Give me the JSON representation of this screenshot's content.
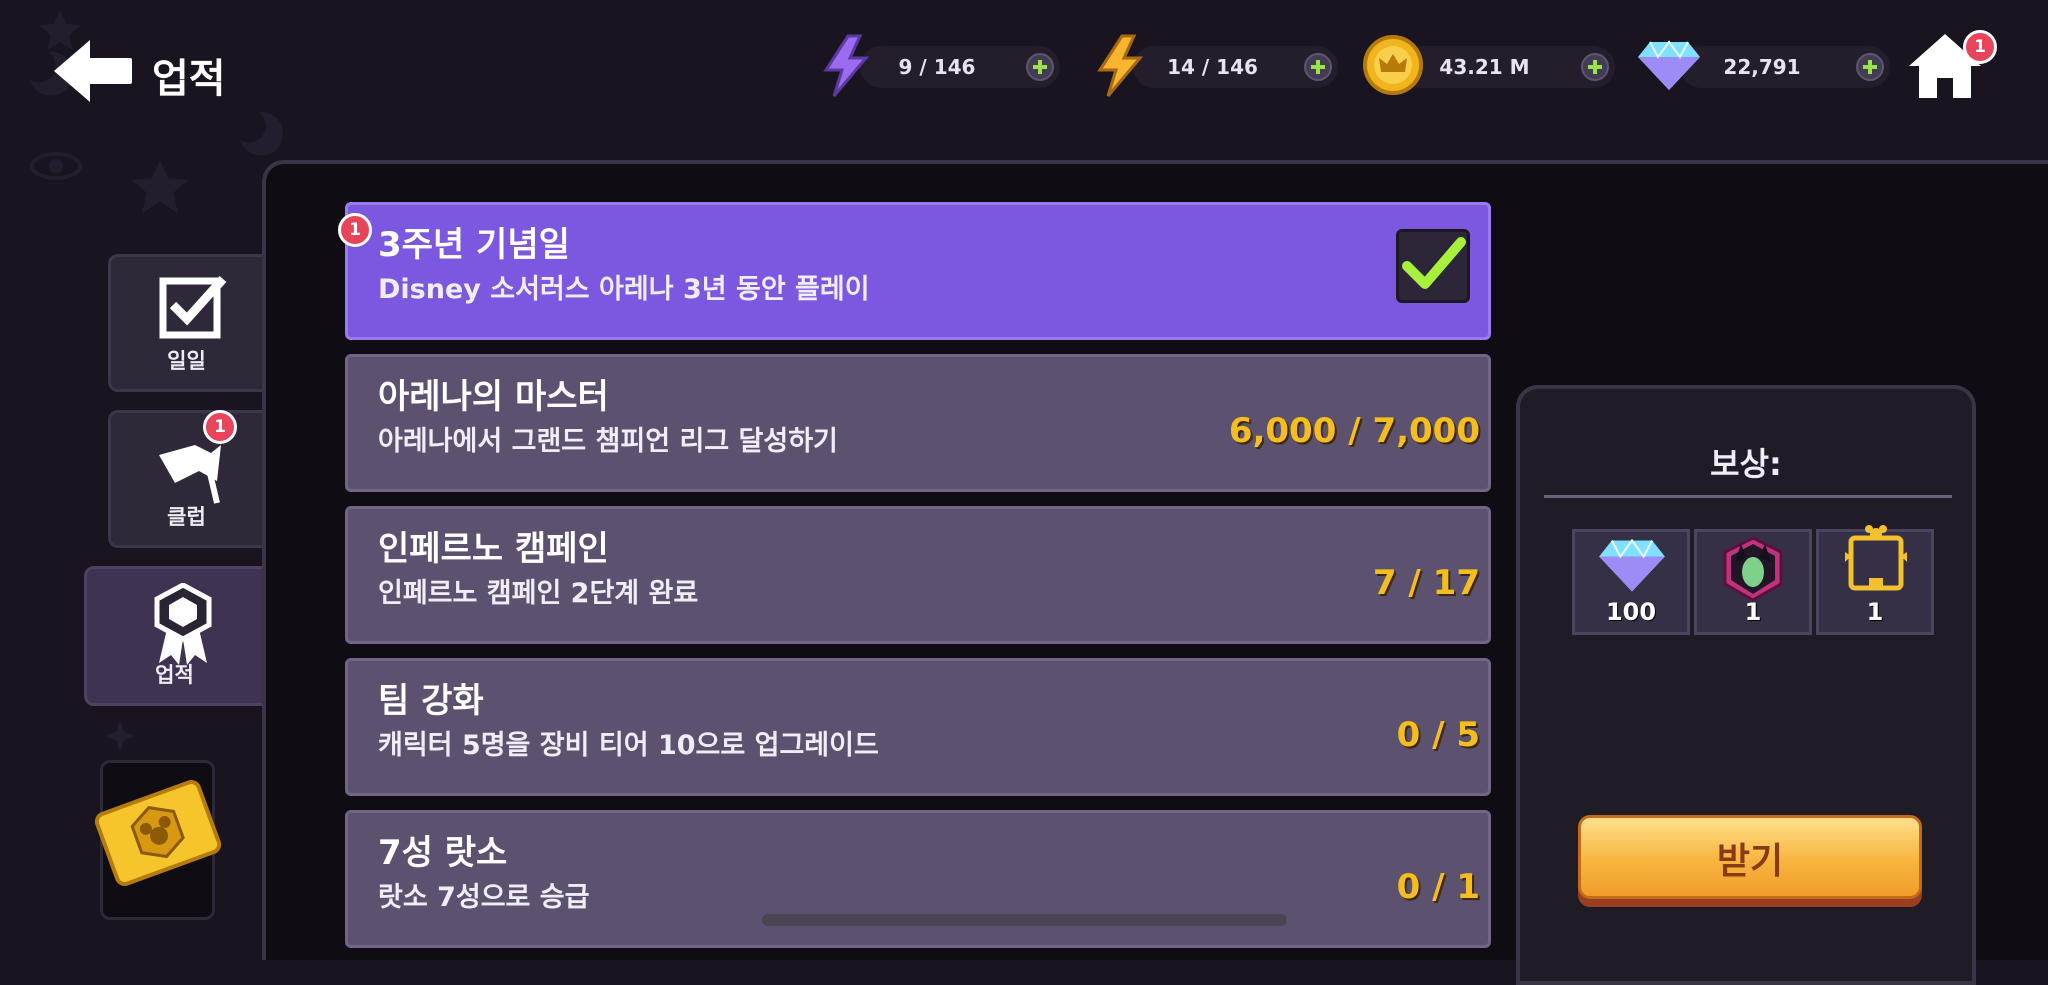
{
  "header": {
    "title": "업적",
    "back_icon": "back-arrow-icon",
    "home_icon": "home-icon",
    "home_badge": "1"
  },
  "resources": [
    {
      "name": "purple-energy",
      "icon": "lightning-purple-icon",
      "value": "9 / 146",
      "color": "#9b6cf0"
    },
    {
      "name": "gold-energy",
      "icon": "lightning-gold-icon",
      "value": "14 / 146",
      "color": "#f7b531"
    },
    {
      "name": "coins",
      "icon": "gold-coin-icon",
      "value": "43.21 M",
      "color": "#f2b51e"
    },
    {
      "name": "gems",
      "icon": "diamond-icon",
      "value": "22,791",
      "color": "#7fe0ff"
    }
  ],
  "tabs": [
    {
      "label": "일일",
      "icon": "checkbox-icon",
      "active": false
    },
    {
      "label": "클럽",
      "icon": "flag-icon",
      "badge": "1",
      "active": false
    },
    {
      "label": "업적",
      "icon": "medal-icon",
      "active": true
    }
  ],
  "ticket_icon": "mickey-ticket-icon",
  "achievements": [
    {
      "title": "3주년 기념일",
      "desc": "Disney 소서러스 아레나 3년 동안 플레이",
      "progress": "",
      "complete": true,
      "badge": "1",
      "selected": true
    },
    {
      "title": "아레나의 마스터",
      "desc": "아레나에서 그랜드 챔피언 리그 달성하기",
      "progress": "6,000 / 7,000",
      "complete": false,
      "selected": false
    },
    {
      "title": "인페르노 캠페인",
      "desc": "인페르노 캠페인 2단계 완료",
      "progress": "7 / 17",
      "complete": false,
      "selected": false
    },
    {
      "title": "팀 강화",
      "desc": "캐릭터 5명을 장비 티어 10으로 업그레이드",
      "progress": "0 / 5",
      "complete": false,
      "selected": false
    },
    {
      "title": "7성 랏소",
      "desc": "랏소 7성으로 승급",
      "progress": "0 / 1",
      "complete": false,
      "selected": false
    }
  ],
  "rewards": {
    "title": "보상:",
    "items": [
      {
        "icon": "diamond-icon",
        "qty": "100"
      },
      {
        "icon": "maleficent-portrait-icon",
        "qty": "1"
      },
      {
        "icon": "golden-frame-icon",
        "qty": "1"
      }
    ],
    "claim_label": "받기"
  }
}
